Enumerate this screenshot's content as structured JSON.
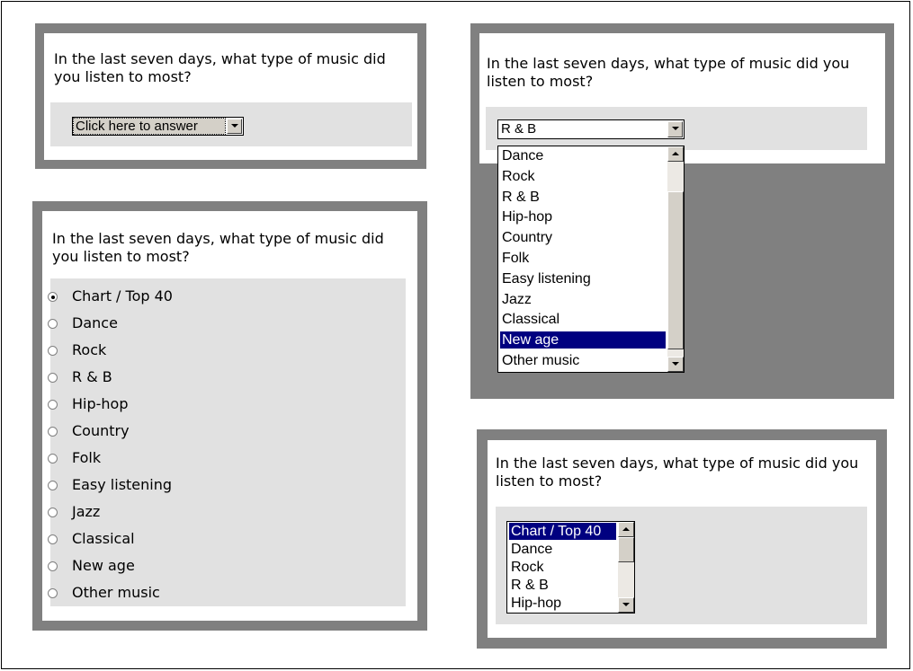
{
  "question": "In the last seven days, what type of music did you listen to most?",
  "panel_dropdown_closed": {
    "selected": "Click here to answer"
  },
  "panel_dropdown_open": {
    "selected": "R & B",
    "options": [
      "Dance",
      "Rock",
      "R & B",
      "Hip-hop",
      "Country",
      "Folk",
      "Easy listening",
      "Jazz",
      "Classical",
      "New age",
      "Other music"
    ],
    "highlighted": "New age"
  },
  "panel_radio": {
    "options": [
      "Chart / Top 40",
      "Dance",
      "Rock",
      "R & B",
      "Hip-hop",
      "Country",
      "Folk",
      "Easy listening",
      "Jazz",
      "Classical",
      "New age",
      "Other music"
    ],
    "selected_index": 0
  },
  "panel_listbox": {
    "options": [
      "Chart / Top 40",
      "Dance",
      "Rock",
      "R & B",
      "Hip-hop"
    ],
    "selected": "Chart / Top 40"
  },
  "colors": {
    "panel_gray": "#808080",
    "answer_area": "#e1e1e1",
    "highlight": "#000080"
  },
  "icons": [
    "dropdown-arrow-icon",
    "scroll-up-icon",
    "scroll-down-icon",
    "radio-icon"
  ]
}
